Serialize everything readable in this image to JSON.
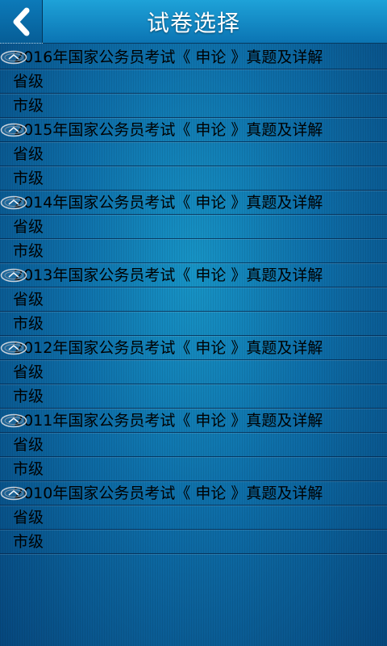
{
  "header": {
    "title": "试卷选择",
    "back_icon": "chevron-left-icon"
  },
  "groups": [
    {
      "title": "2016年国家公务员考试《 申论 》真题及详解",
      "items": [
        "省级",
        "市级"
      ],
      "expanded": true
    },
    {
      "title": "2015年国家公务员考试《 申论 》真题及详解",
      "items": [
        "省级",
        "市级"
      ],
      "expanded": true
    },
    {
      "title": "2014年国家公务员考试《 申论 》真题及详解",
      "items": [
        "省级",
        "市级"
      ],
      "expanded": true
    },
    {
      "title": "2013年国家公务员考试《 申论 》真题及详解",
      "items": [
        "省级",
        "市级"
      ],
      "expanded": true
    },
    {
      "title": "2012年国家公务员考试《 申论 》真题及详解",
      "items": [
        "省级",
        "市级"
      ],
      "expanded": true
    },
    {
      "title": "2011年国家公务员考试《 申论 》真题及详解",
      "items": [
        "省级",
        "市级"
      ],
      "expanded": true
    },
    {
      "title": "2010年国家公务员考试《 申论 》真题及详解",
      "items": [
        "省级",
        "市级"
      ],
      "expanded": true
    }
  ],
  "colors": {
    "header": "#1592cc",
    "background": "#0e6ea8",
    "text": "#000000",
    "title_text": "#ffffff"
  }
}
